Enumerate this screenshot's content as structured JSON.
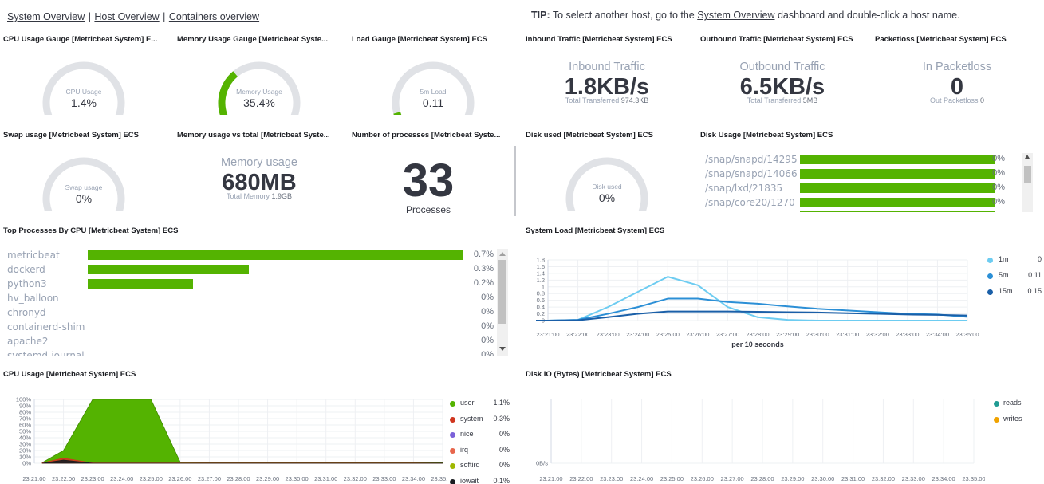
{
  "nav": {
    "links": [
      "System Overview",
      "Host Overview",
      "Containers overview"
    ],
    "separator": "|"
  },
  "tip": {
    "prefix": "TIP:",
    "before": " To select another host, go to the ",
    "link": "System Overview",
    "after": " dashboard and double-click a host name."
  },
  "panels": {
    "cpu_gauge": {
      "title": "CPU Usage Gauge [Metricbeat System] E...",
      "label": "CPU Usage",
      "value": "1.4%",
      "fraction": 0.014
    },
    "mem_gauge": {
      "title": "Memory Usage Gauge [Metricbeat Syste...",
      "label": "Memory Usage",
      "value": "35.4%",
      "fraction": 0.354
    },
    "load_gauge": {
      "title": "Load Gauge [Metricbeat System] ECS",
      "label": "5m Load",
      "value": "0.11",
      "fraction": 0.11
    },
    "inbound": {
      "title": "Inbound Traffic [Metricbeat System] ECS",
      "heading": "Inbound Traffic",
      "value": "1.8KB/s",
      "sub_label": "Total Transferred",
      "sub_value": "974.3KB"
    },
    "outbound": {
      "title": "Outbound Traffic [Metricbeat System] ECS",
      "heading": "Outbound Traffic",
      "value": "6.5KB/s",
      "sub_label": "Total Transferred",
      "sub_value": "5MB"
    },
    "packetloss": {
      "title": "Packetloss [Metricbeat System] ECS",
      "heading": "In Packetloss",
      "value": "0",
      "sub_label": "Out Packetloss",
      "sub_value": "0"
    },
    "swap_gauge": {
      "title": "Swap usage [Metricbeat System] ECS",
      "label": "Swap usage",
      "value": "0%",
      "fraction": 0
    },
    "mem_total": {
      "title": "Memory usage vs total [Metricbeat Syste...",
      "heading": "Memory usage",
      "value": "680MB",
      "sub_label": "Total Memory",
      "sub_value": "1.9GB"
    },
    "processes": {
      "title": "Number of processes [Metricbeat Syste...",
      "value": "33",
      "label": "Processes"
    },
    "disk_gauge": {
      "title": "Disk used [Metricbeat System] ECS",
      "label": "Disk used",
      "value": "0%",
      "fraction": 0
    },
    "disk_usage": {
      "title": "Disk Usage [Metricbeat System] ECS",
      "rows": [
        {
          "label": "/snap/snapd/14295",
          "pct": "0%",
          "fraction": 1
        },
        {
          "label": "/snap/snapd/14066",
          "pct": "0%",
          "fraction": 1
        },
        {
          "label": "/snap/lxd/21835",
          "pct": "0%",
          "fraction": 1
        },
        {
          "label": "/snap/core20/1270",
          "pct": "0%",
          "fraction": 1
        }
      ]
    },
    "top_procs": {
      "title": "Top Processes By CPU [Metricbeat System] ECS",
      "rows": [
        {
          "label": "metricbeat",
          "pct": "0.7%",
          "fraction": 1.0
        },
        {
          "label": "dockerd",
          "pct": "0.3%",
          "fraction": 0.43
        },
        {
          "label": "python3",
          "pct": "0.2%",
          "fraction": 0.28
        },
        {
          "label": "hv_balloon",
          "pct": "0%",
          "fraction": 0
        },
        {
          "label": "chronyd",
          "pct": "0%",
          "fraction": 0
        },
        {
          "label": "containerd-shim",
          "pct": "0%",
          "fraction": 0
        },
        {
          "label": "apache2",
          "pct": "0%",
          "fraction": 0
        },
        {
          "label": "systemd-journal",
          "pct": "0%",
          "fraction": 0
        }
      ]
    },
    "system_load": {
      "title": "System Load [Metricbeat System] ECS",
      "xlabel": "per 10 seconds",
      "legend": [
        {
          "name": "1m",
          "value": "0",
          "color": "#6dccf1"
        },
        {
          "name": "5m",
          "value": "0.11",
          "color": "#2b8fd6"
        },
        {
          "name": "15m",
          "value": "0.15",
          "color": "#1a5fa8"
        }
      ]
    },
    "cpu_usage": {
      "title": "CPU Usage [Metricbeat System] ECS",
      "legend": [
        {
          "name": "user",
          "value": "1.1%",
          "color": "#54b301"
        },
        {
          "name": "system",
          "value": "0.3%",
          "color": "#d0361f"
        },
        {
          "name": "nice",
          "value": "0%",
          "color": "#7b61d9"
        },
        {
          "name": "irq",
          "value": "0%",
          "color": "#e7664c"
        },
        {
          "name": "softirq",
          "value": "0%",
          "color": "#a0b800"
        },
        {
          "name": "iowait",
          "value": "0.1%",
          "color": "#1a1c21"
        }
      ]
    },
    "disk_io": {
      "title": "Disk IO (Bytes) [Metricbeat System] ECS",
      "y_tick": "0B/s",
      "legend": [
        {
          "name": "reads",
          "color": "#209b93"
        },
        {
          "name": "writes",
          "color": "#f0a300"
        }
      ]
    }
  },
  "chart_data": [
    {
      "type": "line",
      "x": [
        "23:21:00",
        "23:22:00",
        "23:23:00",
        "23:24:00",
        "23:25:00",
        "23:26:00",
        "23:27:00",
        "23:28:00",
        "23:29:00",
        "23:30:00",
        "23:31:00",
        "23:32:00",
        "23:33:00",
        "23:34:00",
        "23:35:00"
      ],
      "y_ticks": [
        "1.8",
        "1.6",
        "1.4",
        "1.2",
        "1",
        "0.8",
        "0.6",
        "0.4",
        "0.2",
        "0"
      ],
      "ylim": [
        0,
        1.8
      ],
      "xlabel": "per 10 seconds",
      "series": [
        {
          "name": "1m",
          "values": [
            0,
            0.02,
            0.4,
            0.85,
            1.3,
            1.05,
            0.4,
            0.1,
            0.02,
            0.0,
            0.0,
            0.0,
            0.0,
            0.0,
            0.0
          ]
        },
        {
          "name": "5m",
          "values": [
            0,
            0.02,
            0.2,
            0.4,
            0.65,
            0.65,
            0.55,
            0.5,
            0.42,
            0.35,
            0.3,
            0.25,
            0.2,
            0.18,
            0.11
          ]
        },
        {
          "name": "15m",
          "values": [
            0,
            0.01,
            0.1,
            0.2,
            0.27,
            0.27,
            0.27,
            0.26,
            0.25,
            0.24,
            0.22,
            0.2,
            0.18,
            0.17,
            0.15
          ]
        }
      ]
    },
    {
      "type": "area",
      "x": [
        "23:21:00",
        "23:22:00",
        "23:23:00",
        "23:24:00",
        "23:25:00",
        "23:26:00",
        "23:27:00",
        "23:28:00",
        "23:29:00",
        "23:30:00",
        "23:31:00",
        "23:32:00",
        "23:33:00",
        "23:34:00",
        "23:35:00"
      ],
      "y_ticks": [
        "100%",
        "90%",
        "80%",
        "70%",
        "60%",
        "50%",
        "40%",
        "30%",
        "20%",
        "10%",
        "0%"
      ],
      "ylim": [
        0,
        100
      ],
      "series": [
        {
          "name": "user",
          "values": [
            1,
            20,
            100,
            100,
            100,
            2,
            1,
            1,
            1,
            1,
            1,
            1,
            1,
            1,
            1.1
          ]
        },
        {
          "name": "system",
          "values": [
            0.5,
            8,
            0.5,
            0.5,
            0.5,
            0.5,
            0.5,
            0.5,
            0.5,
            0.5,
            0.5,
            0.5,
            0.5,
            0.5,
            0.3
          ]
        },
        {
          "name": "iowait",
          "values": [
            0,
            5,
            0,
            0,
            0,
            0,
            0,
            0,
            0,
            0,
            0,
            0,
            0,
            0,
            0.1
          ]
        }
      ]
    },
    {
      "type": "line",
      "x": [
        "23:21:00",
        "23:22:00",
        "23:23:00",
        "23:24:00",
        "23:25:00",
        "23:26:00",
        "23:27:00",
        "23:28:00",
        "23:29:00",
        "23:30:00",
        "23:31:00",
        "23:32:00",
        "23:33:00",
        "23:34:00",
        "23:35:00"
      ],
      "y_ticks": [
        "0B/s"
      ],
      "series": [
        {
          "name": "reads",
          "values": []
        },
        {
          "name": "writes",
          "values": []
        }
      ]
    }
  ]
}
